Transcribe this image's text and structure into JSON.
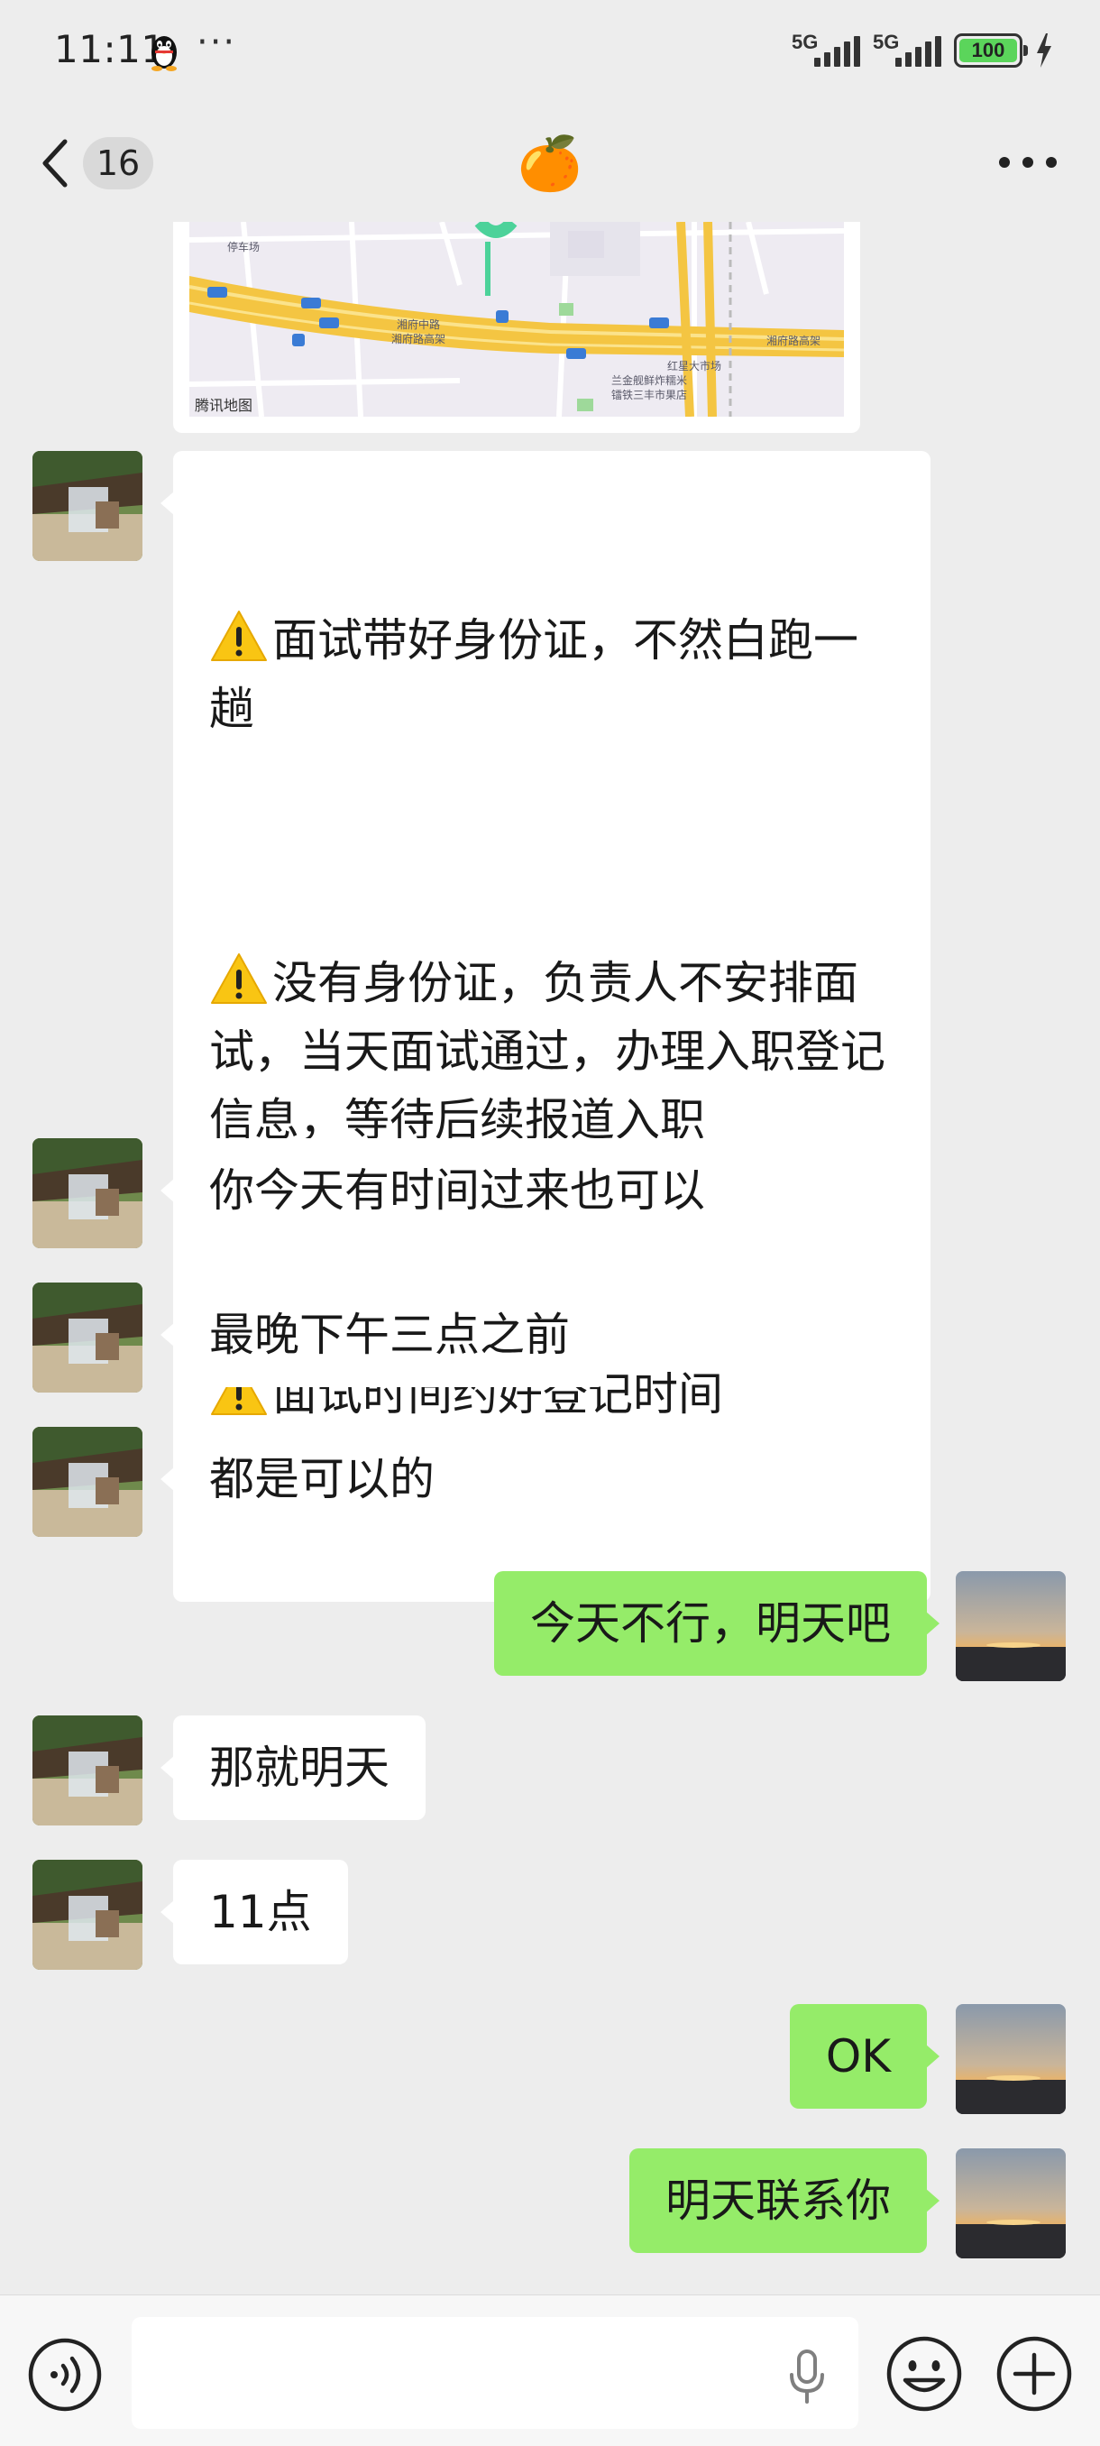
{
  "status_bar": {
    "time": "11:11",
    "signal_1_label": "5G",
    "signal_2_label": "5G",
    "battery": "100",
    "icons": [
      "qq-penguin-icon",
      "more-dots-icon",
      "signal-icon",
      "battery-icon",
      "charging-bolt-icon"
    ]
  },
  "header": {
    "unread_count": "16",
    "title": "🍊",
    "icons": [
      "back-chevron-icon",
      "more-icon"
    ]
  },
  "map_card": {
    "caption": "腾讯地图",
    "labels": [
      "停车场",
      "湘府中路",
      "湘府路高架",
      "红星大市场",
      "湘府路高架",
      "兰金舰鲜炸糯米",
      "镭铁三丰市果店"
    ]
  },
  "messages": [
    {
      "side": "in",
      "paragraphs": [
        "面试带好身份证，不然白跑一趟",
        "没有身份证，负责人不安排面试，当天面试通过，办理入职登记信息，等待后续报道入职",
        "面试时间约好登记时间"
      ]
    },
    {
      "side": "in",
      "text": "你今天有时间过来也可以"
    },
    {
      "side": "in",
      "text": "最晚下午三点之前"
    },
    {
      "side": "in",
      "text": "都是可以的"
    },
    {
      "side": "out",
      "text": "今天不行，明天吧"
    },
    {
      "side": "in",
      "text": "那就明天"
    },
    {
      "side": "in",
      "text": "11点"
    },
    {
      "side": "out",
      "text": "OK"
    },
    {
      "side": "out",
      "text": "明天联系你"
    }
  ],
  "input_bar": {
    "value": "",
    "icons": [
      "voice-icon",
      "microphone-icon",
      "emoji-icon",
      "plus-icon"
    ]
  },
  "colors": {
    "background": "#ededed",
    "incoming_bubble": "#ffffff",
    "outgoing_bubble": "#95ec69",
    "battery_fill": "#5bd55b"
  }
}
